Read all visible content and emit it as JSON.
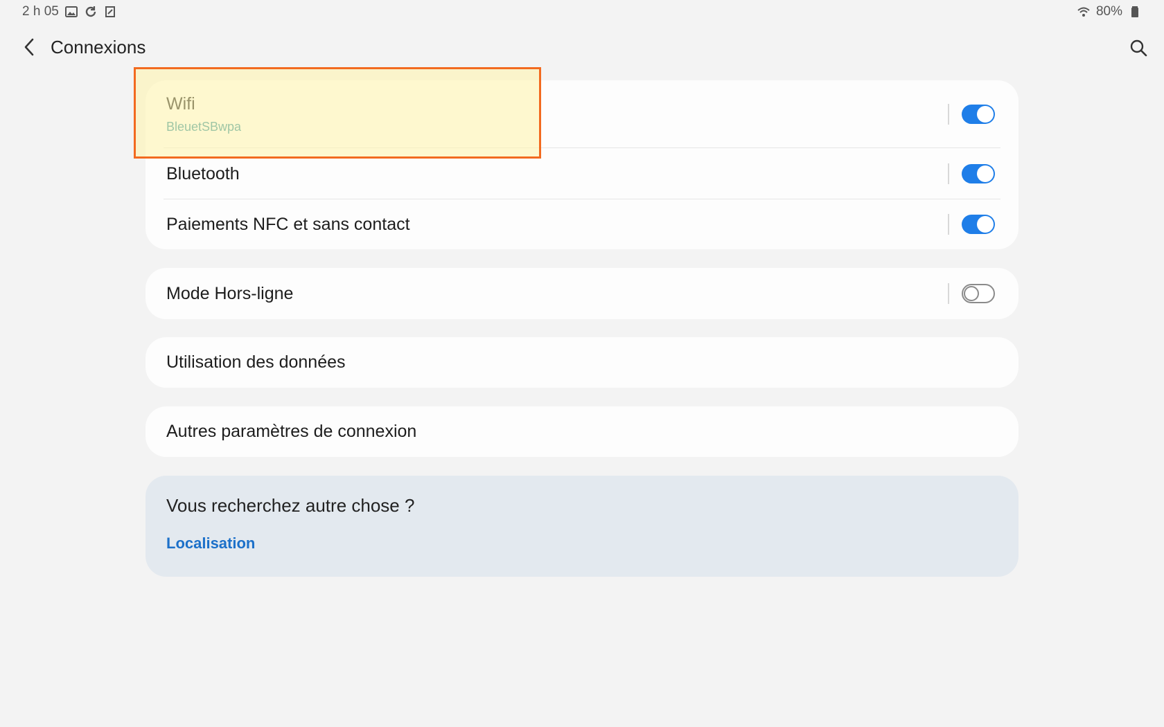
{
  "status_bar": {
    "time": "2 h 05",
    "battery": "80%",
    "left_icons": [
      "gallery-icon",
      "sync-icon",
      "screenshot-icon"
    ],
    "right_icons": [
      "wifi-signal-icon",
      "battery-icon"
    ]
  },
  "header": {
    "title": "Connexions"
  },
  "connections_card": {
    "items": [
      {
        "label": "Wifi",
        "sublabel": "BleuetSBwpa",
        "toggle": "on"
      },
      {
        "label": "Bluetooth",
        "toggle": "on"
      },
      {
        "label": "Paiements NFC et sans contact",
        "toggle": "on"
      }
    ]
  },
  "airplane_card": {
    "label": "Mode Hors-ligne",
    "toggle": "off"
  },
  "data_usage": {
    "label": "Utilisation des données"
  },
  "more_settings": {
    "label": "Autres paramètres de connexion"
  },
  "suggestion": {
    "title": "Vous recherchez autre chose ?",
    "link": "Localisation"
  },
  "colors": {
    "accent": "#1f7ee8",
    "highlight_border": "#f26a1f",
    "highlight_fill": "#fff4aa",
    "link": "#1c70c9",
    "sublabel": "#2b8fa0"
  }
}
